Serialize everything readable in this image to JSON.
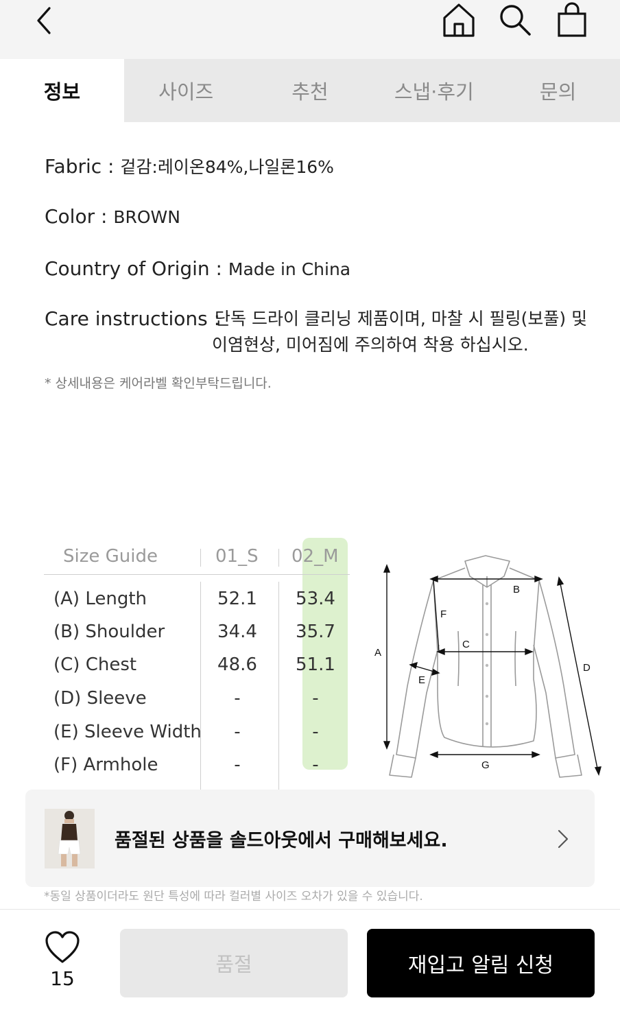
{
  "header": {
    "icons": [
      "back-icon",
      "home-icon",
      "search-icon",
      "bag-icon"
    ]
  },
  "tabs": [
    {
      "label": "정보",
      "active": true
    },
    {
      "label": "사이즈",
      "active": false
    },
    {
      "label": "추천",
      "active": false
    },
    {
      "label": "스냅·후기",
      "active": false
    },
    {
      "label": "문의",
      "active": false
    }
  ],
  "info": {
    "fabric_label": "Fabric : ",
    "fabric_value": "겉감:레이온84%,나일론16%",
    "color_label": "Color : ",
    "color_value": "BROWN",
    "origin_label": "Country of Origin : ",
    "origin_value": "Made in China",
    "care_label": "Care instructions : ",
    "care_value_line1": "단독 드라이 클리닝 제품이며, 마찰 시 필링(보풀) 및",
    "care_value_line2": "이염현상, 미어짐에 주의하여 착용 하십시오.",
    "note": "* 상세내용은 케어라벨 확인부탁드립니다."
  },
  "size_guide": {
    "title": "Size Guide",
    "columns": [
      "01_S",
      "02_M"
    ],
    "highlight_color": "#d7efc6",
    "rows": [
      {
        "label": "(A) Length",
        "values": [
          "52.1",
          "53.4"
        ]
      },
      {
        "label": "(B) Shoulder",
        "values": [
          "34.4",
          "35.7"
        ]
      },
      {
        "label": "(C) Chest",
        "values": [
          "48.6",
          "51.1"
        ]
      },
      {
        "label": "(D) Sleeve",
        "values": [
          "-",
          "-"
        ]
      },
      {
        "label": "(E) Sleeve Width",
        "values": [
          "-",
          "-"
        ]
      },
      {
        "label": "(F) Armhole",
        "values": [
          "-",
          "-"
        ]
      }
    ],
    "diagram_letters": {
      "a": "A",
      "b": "B",
      "c": "C",
      "d": "D",
      "e": "E",
      "f": "F",
      "g": "G"
    }
  },
  "soldout_card": {
    "text": "품절된 상품을 솔드아웃에서 구매해보세요."
  },
  "disclaimer": "*동일 상품이더라도 원단 특성에 따라 컬러별 사이즈 오차가 있을 수 있습니다.",
  "bottom_bar": {
    "like_count": "15",
    "soldout_label": "품절",
    "restock_label": "재입고 알림 신청"
  }
}
